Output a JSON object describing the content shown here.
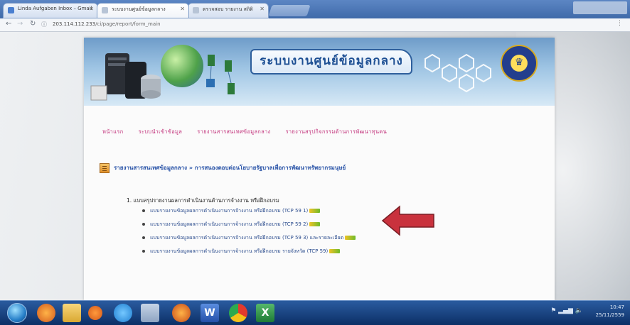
{
  "browser": {
    "tabs": [
      {
        "label": "Linda Aufgaben Inbox – Gmail"
      },
      {
        "label": "ระบบงานศูนย์ข้อมูลกลาง"
      },
      {
        "label": "ตรวจสอบ รายงาน สถิติ"
      }
    ],
    "address": {
      "host": "203.114.112.233",
      "path": "/ci/page/report/form_main"
    }
  },
  "site": {
    "banner_title": "ระบบงานศูนย์ข้อมูลกลาง",
    "nav": [
      {
        "label": "หน้าแรก"
      },
      {
        "label": "ระบบนำเข้าข้อมูล"
      },
      {
        "label": "รายงานสารสนเทศข้อมูลกลาง"
      },
      {
        "label": "รายงานสรุปกิจกรรมด้านการพัฒนาทุนคน"
      }
    ],
    "report_title": "รายงานสารสนเทศข้อมูลกลาง » การสนองตอบต่อนโยบายรัฐบาลเพื่อการพัฒนาทรัพยากรมนุษย์",
    "section_head": "1. แบบสรุปรายงานผลการดำเนินงานด้านการจ้างงาน หรือฝึกอบรม",
    "reports": [
      {
        "label": "แบบรายงานข้อมูลผลการดำเนินงานการจ้างงาน หรือฝึกอบรม (TCP 59 1)",
        "badge": "new"
      },
      {
        "label": "แบบรายงานข้อมูลผลการดำเนินงานการจ้างงาน หรือฝึกอบรม (TCP 59 2)",
        "badge": "new"
      },
      {
        "label": "แบบรายงานข้อมูลผลการดำเนินงานการจ้างงาน หรือฝึกอบรม (TCP 59 3) และรายละเอียด",
        "badge": "new"
      },
      {
        "label": "แบบรายงานข้อมูลผลการดำเนินงานการจ้างงาน หรือฝึกอบรม รายจังหวัด (TCP 59)",
        "badge": "new"
      }
    ],
    "arrow_color": "#c9323d"
  },
  "taskbar": {
    "apps": [
      {
        "icon": "firefox-icon"
      },
      {
        "icon": "explorer-folder-icon"
      },
      {
        "icon": "media-icon"
      },
      {
        "icon": "skype-icon"
      },
      {
        "icon": "calculator-icon"
      },
      {
        "icon": "firefox-icon"
      },
      {
        "icon": "word-icon"
      },
      {
        "icon": "chrome-icon"
      },
      {
        "icon": "excel-icon"
      }
    ],
    "clock": {
      "time": "10:47",
      "date": "25/11/2559"
    }
  }
}
